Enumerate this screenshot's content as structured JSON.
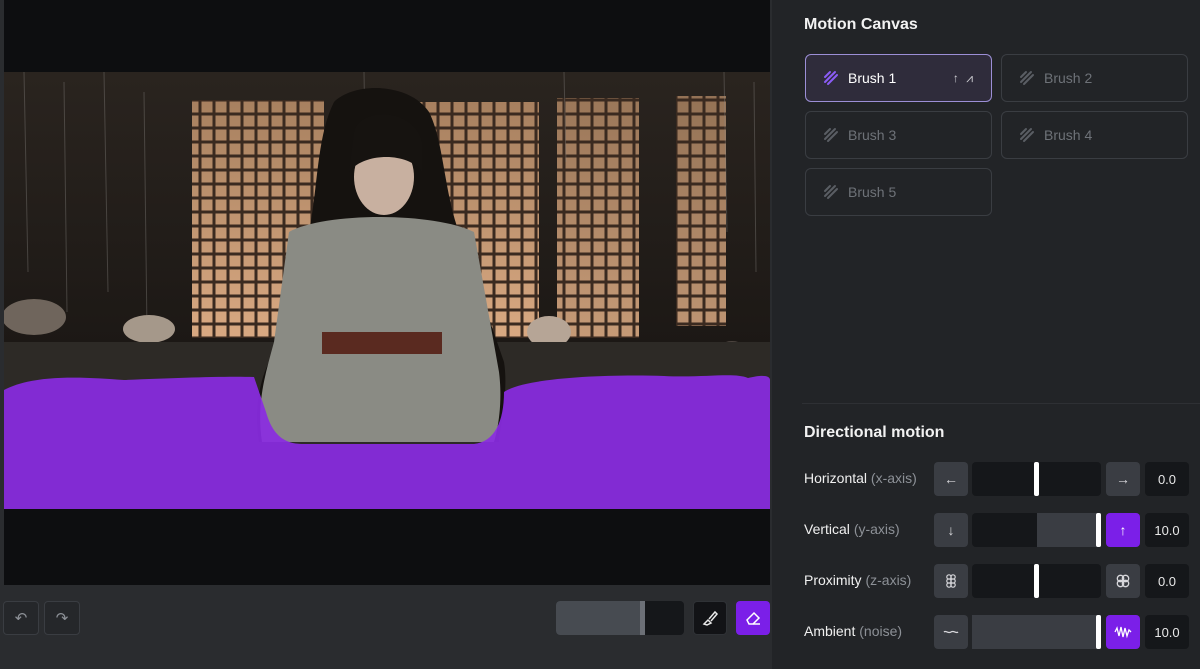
{
  "canvas": {
    "undo_icon": "undo-icon",
    "redo_icon": "redo-icon",
    "brush_size": 0.68,
    "tools": {
      "brush_icon": "paint-brush-icon",
      "eraser_icon": "eraser-icon"
    },
    "accent": "#7b1fe8",
    "mask_color": "#8a2be2"
  },
  "panel": {
    "motion_title": "Motion Canvas",
    "brushes": [
      {
        "label": "Brush 1",
        "active": true,
        "indicator": "↑ ⩘"
      },
      {
        "label": "Brush 2",
        "active": false
      },
      {
        "label": "Brush 3",
        "active": false
      },
      {
        "label": "Brush 4",
        "active": false
      },
      {
        "label": "Brush 5",
        "active": false
      }
    ],
    "directional_title": "Directional motion",
    "rows": [
      {
        "label": "Horizontal",
        "sub": "(x-axis)",
        "left_icon": "←",
        "right_icon": "→",
        "value": "0.0",
        "fraction": 0.5,
        "fill_side": "none",
        "right_active": false
      },
      {
        "label": "Vertical",
        "sub": "(y-axis)",
        "left_icon": "↓",
        "right_icon": "↑",
        "value": "10.0",
        "fraction": 1.0,
        "fill_side": "center-right",
        "right_active": true
      },
      {
        "label": "Proximity",
        "sub": "(z-axis)",
        "left_icon": "⦂",
        "right_icon": "✿",
        "value": "0.0",
        "fraction": 0.5,
        "fill_side": "none",
        "right_active": false
      },
      {
        "label": "Ambient",
        "sub": "(noise)",
        "left_icon": "〰",
        "right_icon": "⩘",
        "value": "10.0",
        "fraction": 1.0,
        "fill_side": "full",
        "right_active": true
      }
    ]
  }
}
